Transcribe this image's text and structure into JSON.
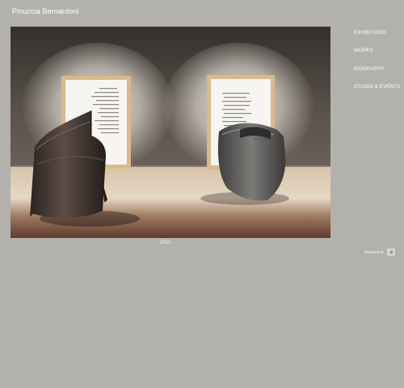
{
  "header": {
    "site_title": "Pinuccia Bernardoni"
  },
  "nav": {
    "items": [
      {
        "label": "EXHIBITIONS"
      },
      {
        "label": "WORKS"
      },
      {
        "label": "BIOGRAPHY"
      },
      {
        "label": "STUDIO & EVENTS"
      }
    ]
  },
  "main": {
    "caption": "2011"
  },
  "footer": {
    "credit_label": "designed by",
    "credit_logo_icon": "designer-logo-icon"
  },
  "colors": {
    "page_background": "#b3b1ac",
    "text": "#ffffff"
  }
}
